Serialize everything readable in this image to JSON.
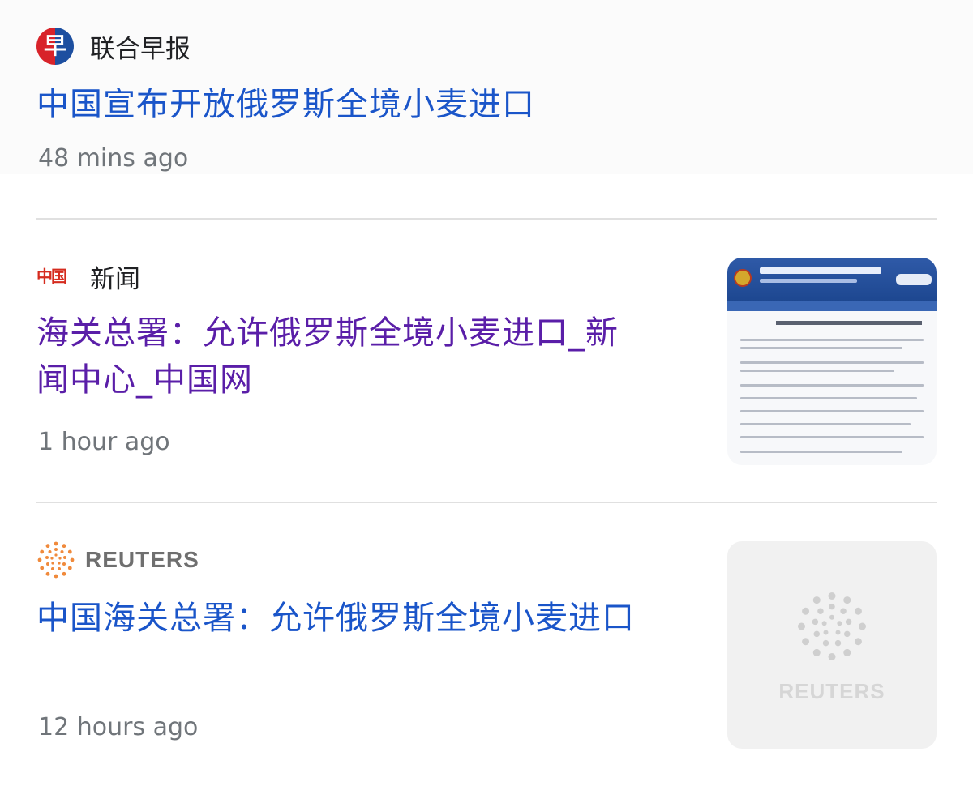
{
  "items": [
    {
      "source": "联合早报",
      "logo_text": "早",
      "headline": "中国宣布开放俄罗斯全境小麦进口",
      "time": "48 mins ago"
    },
    {
      "source": "新闻",
      "logo_text": "中国",
      "headline_line1": "海关总署：允许俄罗斯全境小麦进口_新",
      "headline_line2": "闻中心_中国网",
      "time": "1 hour ago",
      "thumbnail": "customs-document-screenshot"
    },
    {
      "source": "REUTERS",
      "headline": "中国海关总署：允许俄罗斯全境小麦进口",
      "time": "12 hours ago",
      "thumbnail_text": "REUTERS"
    }
  ],
  "colors": {
    "link": "#1a55c9",
    "visited_link": "#5a1ea8",
    "meta_text": "#70757a",
    "divider": "#e0e0e0"
  }
}
